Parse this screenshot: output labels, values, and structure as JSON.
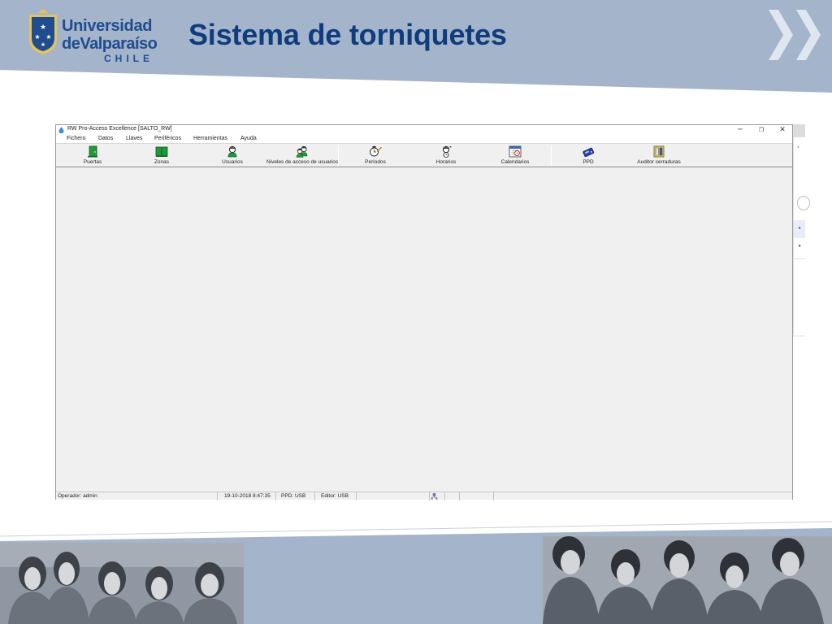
{
  "slide": {
    "title": "Sistema de torniquetes",
    "logo": {
      "line1": "Universidad",
      "line2": "deValparaíso",
      "line3": "CHILE"
    },
    "colors": {
      "header_band": "#a4b4ca",
      "title": "#0f3c7c",
      "logo_blue": "#1f4d8f",
      "logo_gold": "#e4c35c",
      "footer_band": "#a4b4ca"
    }
  },
  "app": {
    "window_title": "RW Pro-Access Excellence [SALTO_RW]",
    "window_controls": [
      "minimize-icon",
      "restore-icon",
      "close-icon"
    ],
    "menu": [
      "Fichero",
      "Datos",
      "Llaves",
      "Periféricos",
      "Herramientas",
      "Ayuda"
    ],
    "toolbar": [
      {
        "label": "Puertas",
        "icon": "door-icon"
      },
      {
        "label": "Zonas",
        "icon": "zones-icon"
      },
      {
        "label": "Usuarios",
        "icon": "user-icon"
      },
      {
        "label": "Niveles de acceso de usuarios",
        "icon": "user-access-levels-icon"
      },
      {
        "label": "Periodos",
        "icon": "clock-pen-icon"
      },
      {
        "label": "Horarios",
        "icon": "schedule-person-icon"
      },
      {
        "label": "Calendarios",
        "icon": "calendar-icon"
      },
      {
        "label": "PPD",
        "icon": "ppd-device-icon"
      },
      {
        "label": "Auditor cerraduras",
        "icon": "lock-audit-icon"
      }
    ],
    "status": {
      "operator": "Operador: admin",
      "datetime": "19-10-2018 8:47:35",
      "ppd": "PPD: USB",
      "encoder": "Editor: USB"
    }
  }
}
